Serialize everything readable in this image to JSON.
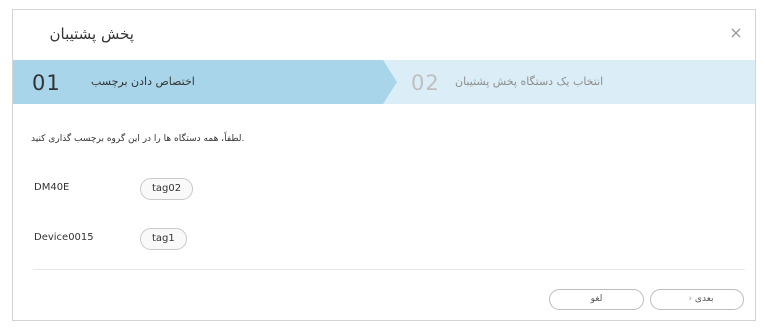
{
  "dialog": {
    "title": "پخش پشتیبان",
    "close_glyph": "×"
  },
  "steps": [
    {
      "number": "01",
      "label": "اختصاص دادن برچسب",
      "active": true
    },
    {
      "number": "02",
      "label": "انتخاب یک دستگاه پخش پشتیبان",
      "active": false
    }
  ],
  "instruction": ".لطفاً، همه دستگاه ها را در این گروه برچسب گذاری کنید",
  "devices": [
    {
      "name": "DM40E",
      "tag": "tag02"
    },
    {
      "name": "Device0015",
      "tag": "tag1"
    }
  ],
  "footer": {
    "next_label": "بعدی",
    "next_icon": "‹",
    "cancel_label": "لغو"
  },
  "colors": {
    "active_step": "#a9d5eb",
    "inactive_step": "#dbeef7"
  }
}
